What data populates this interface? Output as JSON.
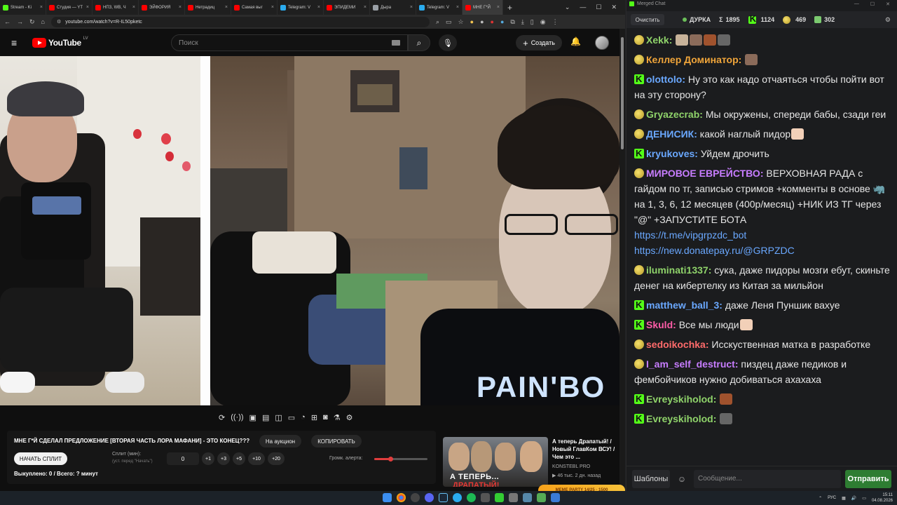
{
  "browser": {
    "tabs": [
      {
        "label": "Stream - Ki",
        "color": "#53fc18"
      },
      {
        "label": "Студия — YT",
        "color": "#ff0000"
      },
      {
        "label": "НПЗ, WB, Ч",
        "color": "#ff0000"
      },
      {
        "label": "ЭЙФОРИЯ",
        "color": "#ff0000"
      },
      {
        "label": "Нетрадиц",
        "color": "#ff0000"
      },
      {
        "label": "Самая выг",
        "color": "#ff0000"
      },
      {
        "label": "Telegram: V",
        "color": "#2aabee"
      },
      {
        "label": "ЭПИДЕМИ",
        "color": "#ff0000"
      },
      {
        "label": "Дыра",
        "color": "#9aa0a6"
      },
      {
        "label": "Telegram: V",
        "color": "#2aabee"
      },
      {
        "label": "МНЕ Г*Й",
        "color": "#ff0000"
      }
    ],
    "url": "youtube.com/watch?v=R-IL50pketc"
  },
  "youtube": {
    "logo_text": "YouTube",
    "region": "LV",
    "search_placeholder": "Поиск",
    "create_label": "Создать"
  },
  "video_info": {
    "title": "МНЕ Г*Й СДЕЛАЛ ПРЕДЛОЖЕНИЕ [ВТОРАЯ ЧАСТЬ ЛОРА МАФАНИ] - ЭТО КОНЕЦ???",
    "auction_label": "На аукцион",
    "copy_label": "КОПИРОВАТЬ",
    "split_button": "НАЧАТЬ СПЛИТ",
    "split_label": "Сплит (мин):",
    "split_hint": "(уст. перед \"Начать\")",
    "split_value": "0",
    "increments": [
      "+1",
      "+3",
      "+5",
      "+10",
      "+20"
    ],
    "volume_label": "Громк. алерта:",
    "volume_level": 0.3,
    "bought": "Выкуплено: 0 / Всего: ? минут"
  },
  "recommendation": {
    "thumb_caption": "А ТЕПЕРЬ...",
    "thumb_caption2": "ДРАПАТЫЙ!",
    "title": "А теперь Драпатый! / Новый ГлавКом ВСУ! / Чем это ...",
    "channel": "KONSTEBL PRO",
    "meta": "▶ 46 тыс.  2 дн. назад"
  },
  "chat": {
    "window_title": "Merged Chat",
    "clear_label": "Очистить",
    "channel": "ДУРКА",
    "stats": [
      {
        "icon": "sum",
        "value": "1895"
      },
      {
        "icon": "kick",
        "value": "1124"
      },
      {
        "icon": "sub",
        "value": "469"
      },
      {
        "icon": "tg",
        "value": "302"
      }
    ],
    "messages": [
      {
        "badge": "sub",
        "nick": "Xekk",
        "color": "#8fd36a",
        "text": "",
        "emotes": 4
      },
      {
        "badge": "sub",
        "nick": "Келлер Доминатор",
        "color": "#f0a53a",
        "text": "",
        "emotes": 1
      },
      {
        "badge": "kick",
        "nick": "olottolo",
        "color": "#6aa8ff",
        "text": "Ну это как надо отчаяться чтобы пойти вот на эту сторону?"
      },
      {
        "badge": "sub",
        "nick": "Gryazecrab",
        "color": "#8fd36a",
        "text": "Мы окружены, спереди бабы, сзади геи"
      },
      {
        "badge": "sub",
        "nick": "ДЕНИСИК",
        "color": "#6aa8ff",
        "text": "какой наглый пидор",
        "emotes": 1
      },
      {
        "badge": "kick",
        "nick": "kryukoves",
        "color": "#6aa8ff",
        "text": "Уйдем дрочить"
      },
      {
        "badge": "sub",
        "nick": "МИРОВОЕ ЕВРЕЙСТВО",
        "color": "#c77dff",
        "text": "ВЕРХОВНАЯ РАДА с гайдом по тг, записью стримов +комменты в основе 🦏 на 1, 3, 6, 12 месяцев (400р/месяц) +НИК ИЗ ТГ через \"@\" +ЗАПУСТИТЕ БОТА",
        "link1": "https://t.me/vipgrpzdc_bot",
        "link2": "https://new.donatepay.ru/@GRPZDC"
      },
      {
        "badge": "sub",
        "nick": "iluminati1337",
        "color": "#8fd36a",
        "text": "сука, даже пидоры мозги ебут, скиньте денег на кибертелку из Китая за мильйон"
      },
      {
        "badge": "kick",
        "nick": "matthew_ball_3",
        "color": "#6aa8ff",
        "text": "даже Леня Пуншик вахуе"
      },
      {
        "badge": "kick",
        "nick": "Skuld",
        "color": "#ff5ca8",
        "text": "Все мы люди",
        "emotes": 1
      },
      {
        "badge": "sub",
        "nick": "sedoikochka",
        "color": "#ff6b6b",
        "text": "Исскуственная матка в разработке"
      },
      {
        "badge": "sub",
        "nick": "I_am_self_destruct",
        "color": "#c77dff",
        "text": "пиздец даже педиков и фембойчиков нужно добиваться ахахаха"
      },
      {
        "badge": "kick",
        "nick": "Evreyskiholod",
        "color": "#8fd36a",
        "text": "",
        "emotes": 1
      },
      {
        "badge": "kick",
        "nick": "Evreyskiholod",
        "color": "#8fd36a",
        "text": "",
        "emotes": 1
      }
    ],
    "templates_label": "Шаблоны",
    "input_placeholder": "Сообщение...",
    "send_label": "Отправить"
  },
  "taskbar": {
    "lang": "РУС",
    "time": "15:11",
    "date": "04.08.2026",
    "widget_text": "MEME PARTY  14/25 · 1500"
  }
}
